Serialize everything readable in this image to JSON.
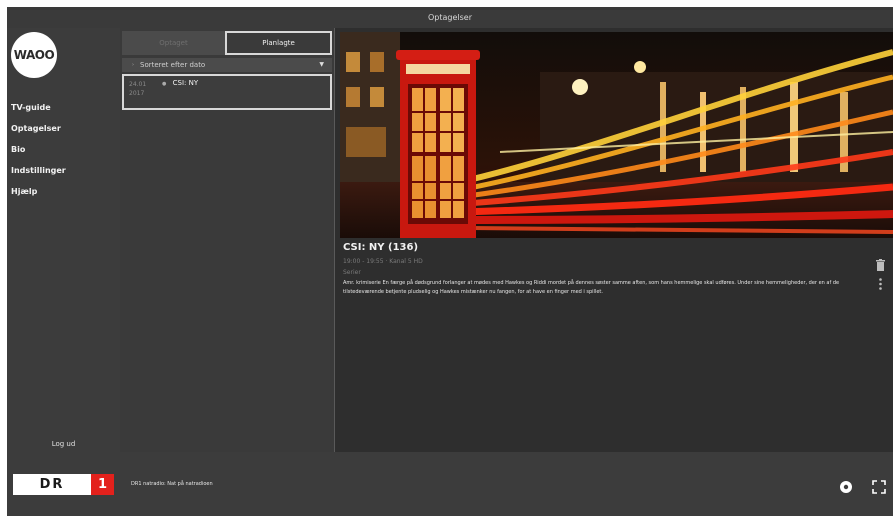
{
  "window": {
    "title": "Optagelser"
  },
  "sidebar": {
    "logo_text": "WAOO",
    "items": [
      {
        "label": "TV-guide"
      },
      {
        "label": "Optagelser"
      },
      {
        "label": "Bio"
      },
      {
        "label": "Indstillinger"
      },
      {
        "label": "Hjælp"
      }
    ],
    "logout_label": "Log ud"
  },
  "list": {
    "tabs": [
      {
        "label": "Optaget",
        "active": false
      },
      {
        "label": "Planlagte",
        "active": true
      }
    ],
    "sort_label": "Sorteret efter dato",
    "items": [
      {
        "date": "24.01 2017",
        "title": "CSI: NY"
      }
    ]
  },
  "detail": {
    "title": "CSI: NY (136)",
    "time": "19:00 - 19:55 · Kanal 5 HD",
    "genre": "Serier",
    "description": "Amr. krimiserie En færge på dødsgrund forlanger at mødes med Hawkes og Riddi mordet på dennes søster samme aften, som hans hemmelige skal udføres. Under sine hemmeligheder, der en af de tilstedeværende betjente pludselig og Hawkes mistænker nu fangen, for at have en finger med i spillet.",
    "hero_image": "red-telephone-box-night-street",
    "delete_icon": "trash-icon",
    "more_icon": "more-vertical-icon"
  },
  "footer": {
    "channel_name": "DR",
    "channel_number": "1",
    "program_text": "DR1 natradio: Nat på natradioen",
    "settings_icon": "gear-icon",
    "fullscreen_icon": "fullscreen-icon"
  },
  "colors": {
    "background": "#2b2b2b",
    "sidebar": "#3c3c3c",
    "accent_red": "#e3211c",
    "active_border": "#d8d8d8"
  }
}
